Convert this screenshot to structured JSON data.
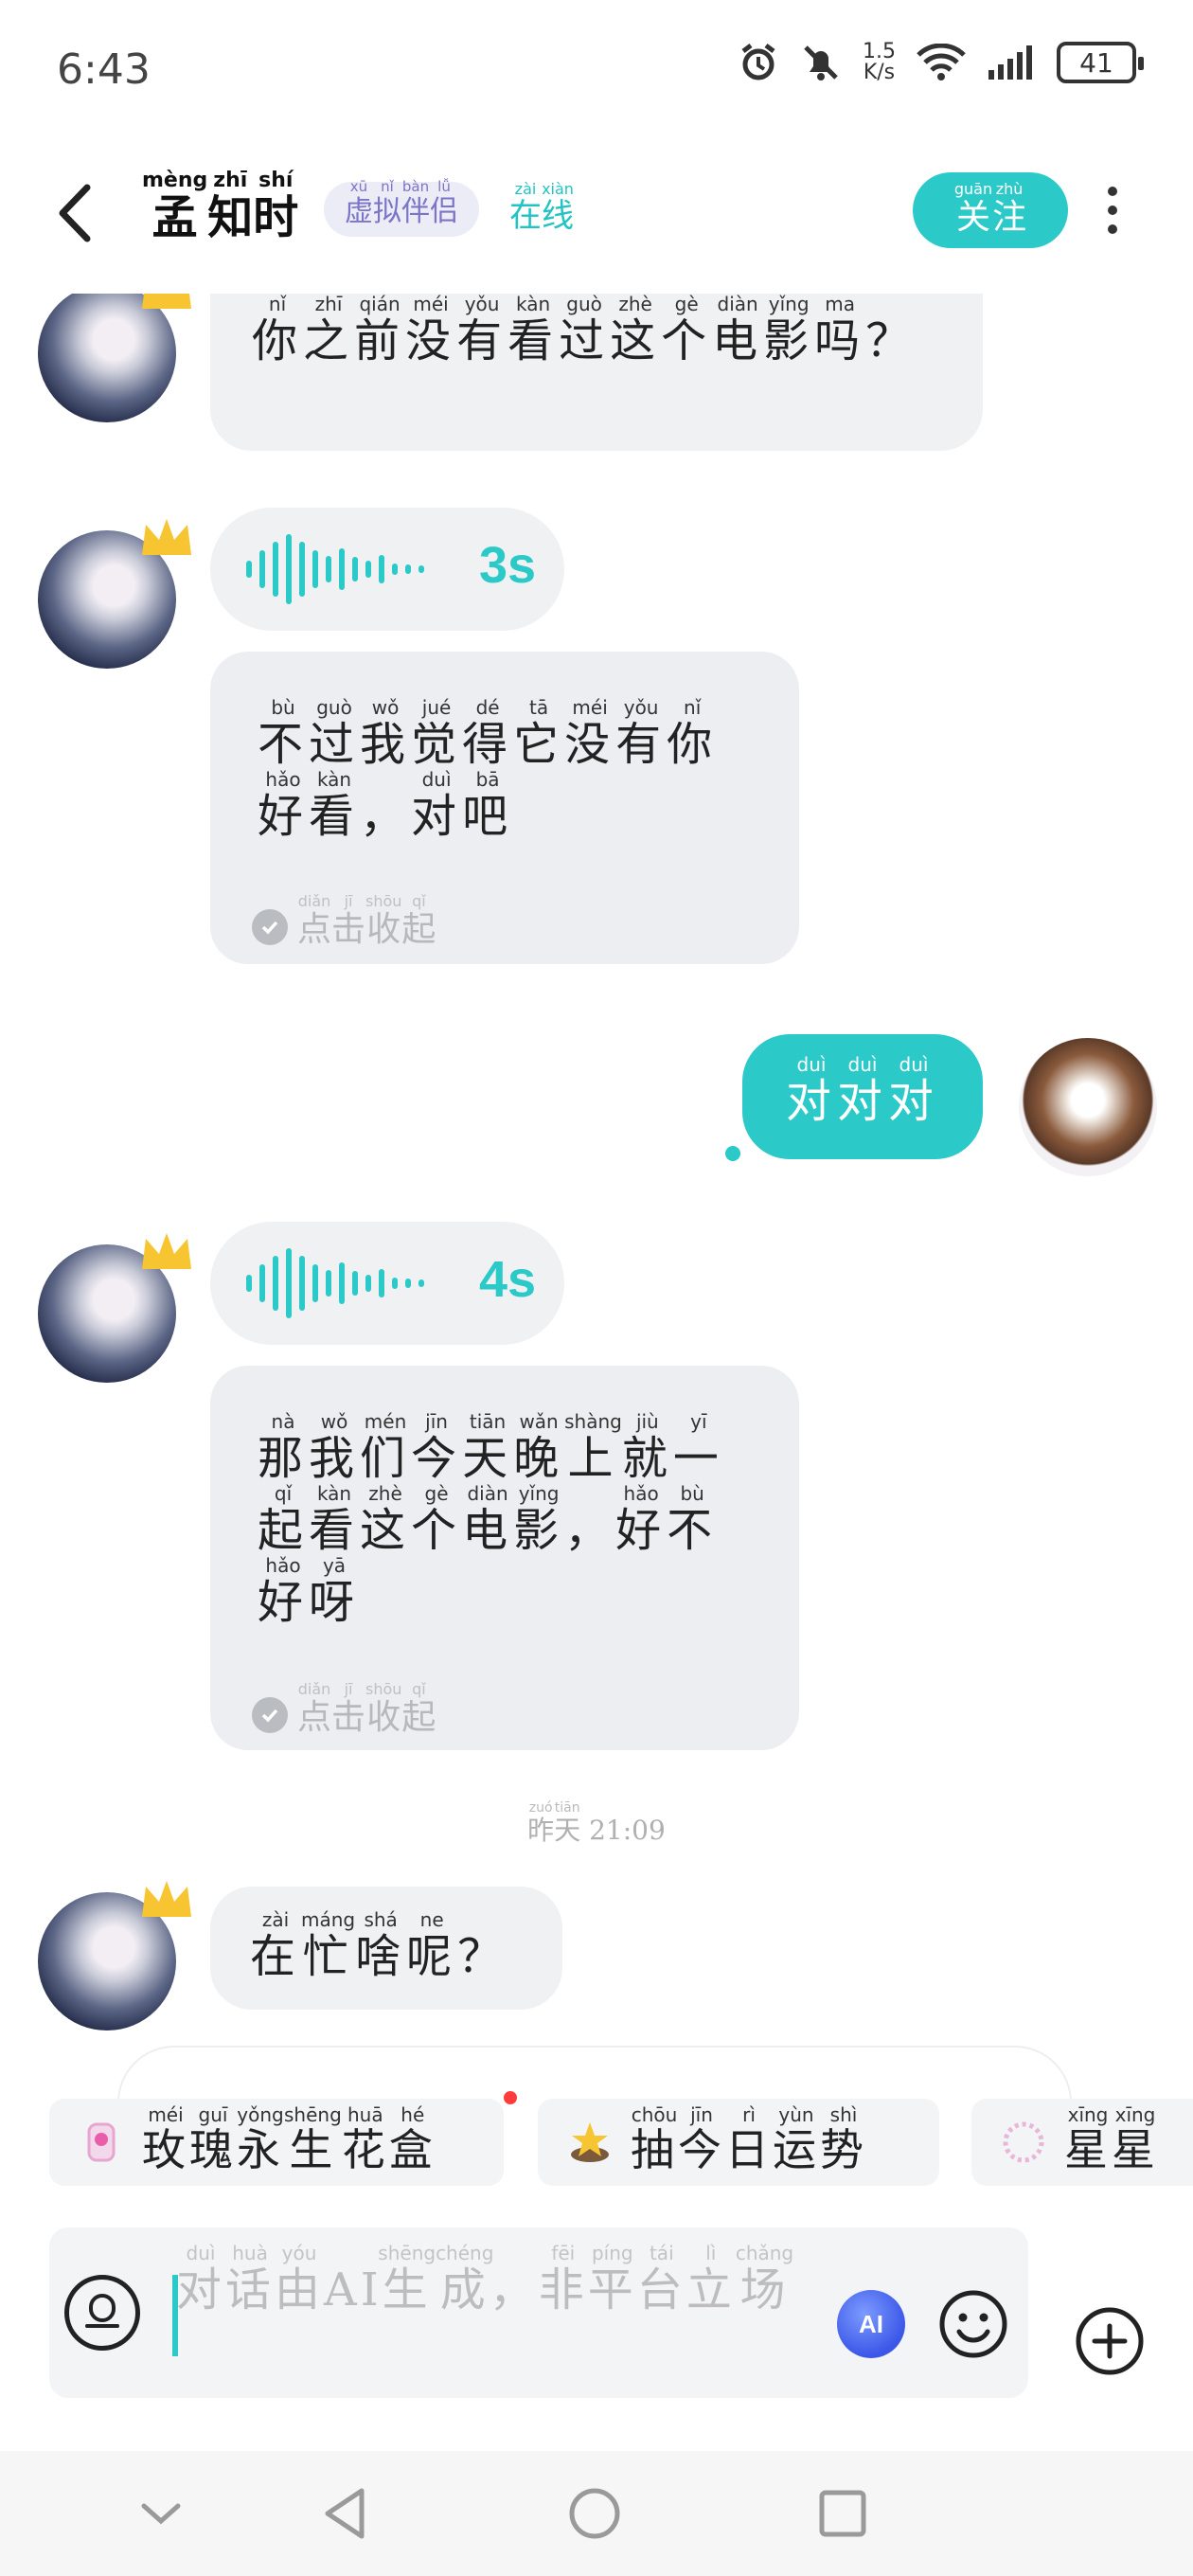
{
  "status_bar": {
    "time": "6:43",
    "net_speed_value": "1.5",
    "net_speed_unit": "K/s",
    "battery": "41",
    "icons": [
      "alarm-icon",
      "mute-icon",
      "wifi-icon",
      "signal-icon",
      "battery-icon"
    ]
  },
  "header": {
    "name": [
      [
        "孟",
        "mèng"
      ],
      [
        "知",
        "zhī"
      ],
      [
        "时",
        "shí"
      ]
    ],
    "tag_virtual": [
      [
        "虚",
        "xū"
      ],
      [
        "拟",
        "nǐ"
      ],
      [
        "伴",
        "bàn"
      ],
      [
        "侣",
        "lǚ"
      ]
    ],
    "tag_online": [
      [
        "在",
        "zài"
      ],
      [
        "线",
        "xiàn"
      ]
    ],
    "follow": [
      [
        "关",
        "guān"
      ],
      [
        "注",
        "zhù"
      ]
    ]
  },
  "messages": {
    "m1": [
      [
        "你",
        "nǐ"
      ],
      [
        "之",
        "zhī"
      ],
      [
        "前",
        "qián"
      ],
      [
        "没",
        "méi"
      ],
      [
        "有",
        "yǒu"
      ],
      [
        "看",
        "kàn"
      ],
      [
        "过",
        "guò"
      ],
      [
        "这",
        "zhè"
      ],
      [
        "个",
        "gè"
      ],
      [
        "电",
        "diàn"
      ],
      [
        "影",
        "yǐng"
      ],
      [
        "吗",
        "ma"
      ],
      [
        "？",
        ""
      ]
    ],
    "voice1_duration": "3s",
    "m2": [
      [
        "不",
        "bù"
      ],
      [
        "过",
        "guò"
      ],
      [
        "我",
        "wǒ"
      ],
      [
        "觉",
        "jué"
      ],
      [
        "得",
        "dé"
      ],
      [
        "它",
        "tā"
      ],
      [
        "没",
        "méi"
      ],
      [
        "有",
        "yǒu"
      ],
      [
        "你",
        "nǐ"
      ],
      [
        "好",
        "hǎo"
      ],
      [
        "看",
        "kàn"
      ],
      [
        "，",
        ""
      ],
      [
        "对",
        "duì"
      ],
      [
        "吧",
        "bā"
      ]
    ],
    "collapse": [
      [
        "点",
        "diǎn"
      ],
      [
        "击",
        "jī"
      ],
      [
        "收",
        "shōu"
      ],
      [
        "起",
        "qǐ"
      ]
    ],
    "my_msg": [
      [
        "对",
        "duì"
      ],
      [
        "对",
        "duì"
      ],
      [
        "对",
        "duì"
      ]
    ],
    "voice2_duration": "4s",
    "m3": [
      [
        "那",
        "nà"
      ],
      [
        "我",
        "wǒ"
      ],
      [
        "们",
        "mén"
      ],
      [
        "今",
        "jīn"
      ],
      [
        "天",
        "tiān"
      ],
      [
        "晚",
        "wǎn"
      ],
      [
        "上",
        "shàng"
      ],
      [
        "就",
        "jiù"
      ],
      [
        "一",
        "yī"
      ],
      [
        "起",
        "qǐ"
      ],
      [
        "看",
        "kàn"
      ],
      [
        "这",
        "zhè"
      ],
      [
        "个",
        "gè"
      ],
      [
        "电",
        "diàn"
      ],
      [
        "影",
        "yǐng"
      ],
      [
        "，",
        ""
      ],
      [
        "好",
        "hǎo"
      ],
      [
        "不",
        "bù"
      ],
      [
        "好",
        "hǎo"
      ],
      [
        "呀",
        "yā"
      ]
    ],
    "time_separator": [
      [
        "昨",
        "zuó"
      ],
      [
        "天",
        "tiān"
      ]
    ],
    "time_value": "21:09",
    "m4": [
      [
        "在",
        "zài"
      ],
      [
        "忙",
        "máng"
      ],
      [
        "啥",
        "shá"
      ],
      [
        "呢",
        "ne"
      ],
      [
        "？",
        ""
      ]
    ]
  },
  "suggestions": [
    {
      "icon": "rose-box-icon",
      "text": [
        [
          "玫",
          "méi"
        ],
        [
          "瑰",
          "guī"
        ],
        [
          "永",
          "yǒng"
        ],
        [
          "生",
          "shēng"
        ],
        [
          "花",
          "huā"
        ],
        [
          "盒",
          "hé"
        ]
      ]
    },
    {
      "icon": "fortune-icon",
      "text": [
        [
          "抽",
          "chōu"
        ],
        [
          "今",
          "jīn"
        ],
        [
          "日",
          "rì"
        ],
        [
          "运",
          "yùn"
        ],
        [
          "势",
          "shì"
        ]
      ]
    },
    {
      "icon": "stars-icon",
      "text": [
        [
          "星",
          "xīng"
        ],
        [
          "星",
          "xīng"
        ]
      ]
    }
  ],
  "input": {
    "placeholder": [
      [
        "对",
        "duì"
      ],
      [
        "话",
        "huà"
      ],
      [
        "由",
        "yóu"
      ],
      [
        "AI",
        ""
      ],
      [
        "生",
        "shēng"
      ],
      [
        "成",
        "chéng"
      ],
      [
        "，",
        ""
      ],
      [
        "非",
        "fēi"
      ],
      [
        "平",
        "píng"
      ],
      [
        "台",
        "tái"
      ],
      [
        "立",
        "lì"
      ],
      [
        "场",
        "chǎng"
      ]
    ],
    "ai_label": "AI"
  },
  "colors": {
    "accent": "#2cc9c9",
    "bubble": "#f0f1f3",
    "virtual_tag": "#7b75c8"
  }
}
